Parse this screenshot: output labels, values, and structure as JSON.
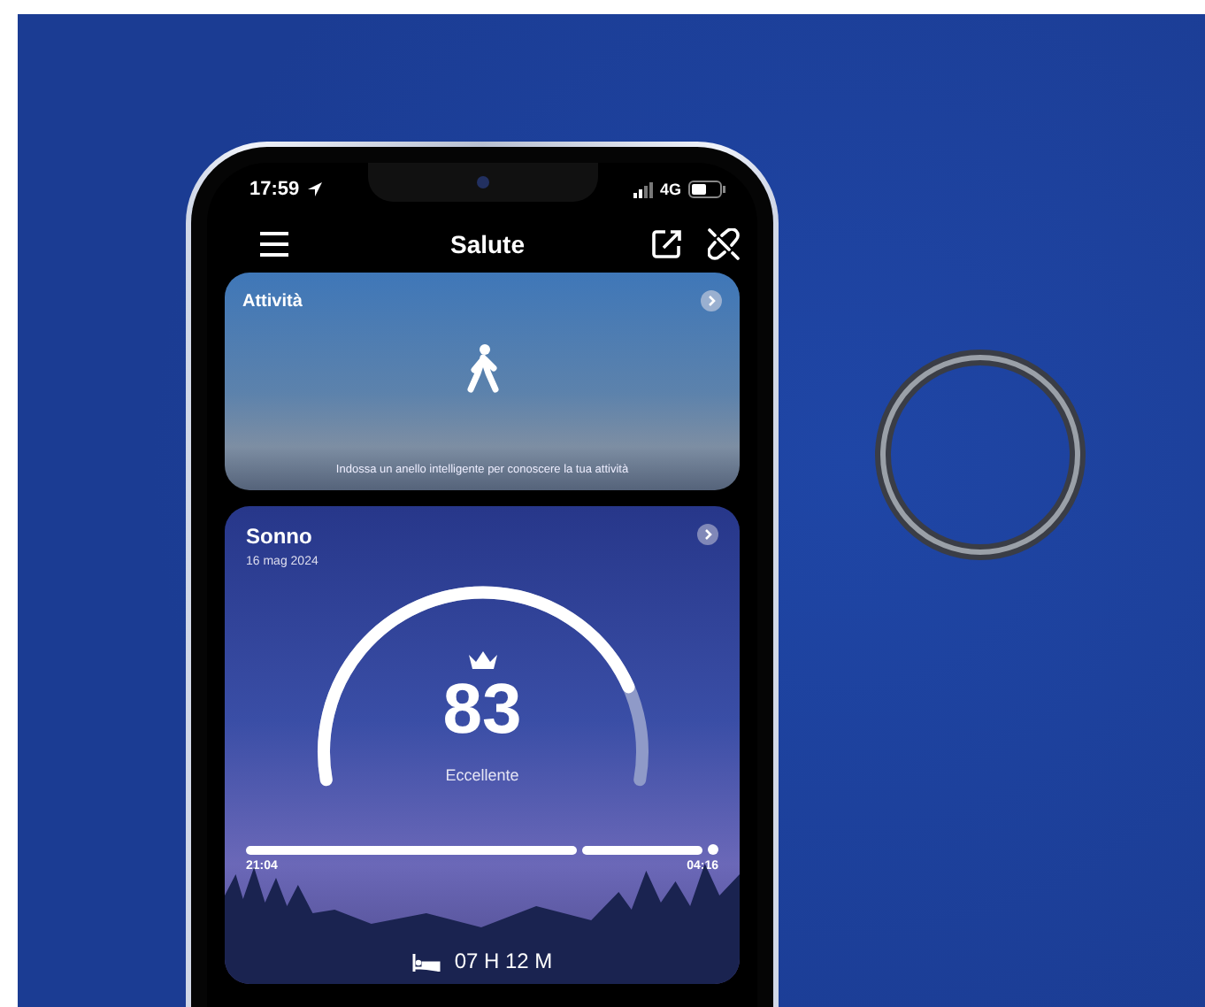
{
  "status_bar": {
    "time": "17:59",
    "network": "4G"
  },
  "header": {
    "title": "Salute"
  },
  "cards": [
    {
      "kind": "activity",
      "title": "Attività",
      "message": "Indossa un anello intelligente per conoscere la tua attività"
    },
    {
      "kind": "sleep",
      "title": "Sonno",
      "date": "16 mag 2024",
      "score": "83",
      "rating": "Eccellente",
      "start": "21:04",
      "end": "04:16",
      "duration": "07 H 12 M"
    }
  ]
}
